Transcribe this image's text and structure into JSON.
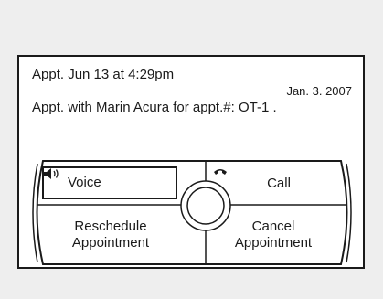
{
  "message": {
    "line1": "Appt. Jun  13 at  4:29pm",
    "date": "Jan. 3. 2007",
    "line2": "Appt. with Marin Acura for appt.#: OT-1 ."
  },
  "buttons": {
    "voice": {
      "label": "Voice",
      "icon": "speaker-icon"
    },
    "call": {
      "label": "Call",
      "icon": "phone-handset-icon"
    },
    "reschedule": {
      "line1": "Reschedule",
      "line2": "Appointment"
    },
    "cancel": {
      "line1": "Cancel",
      "line2": "Appointment"
    }
  }
}
